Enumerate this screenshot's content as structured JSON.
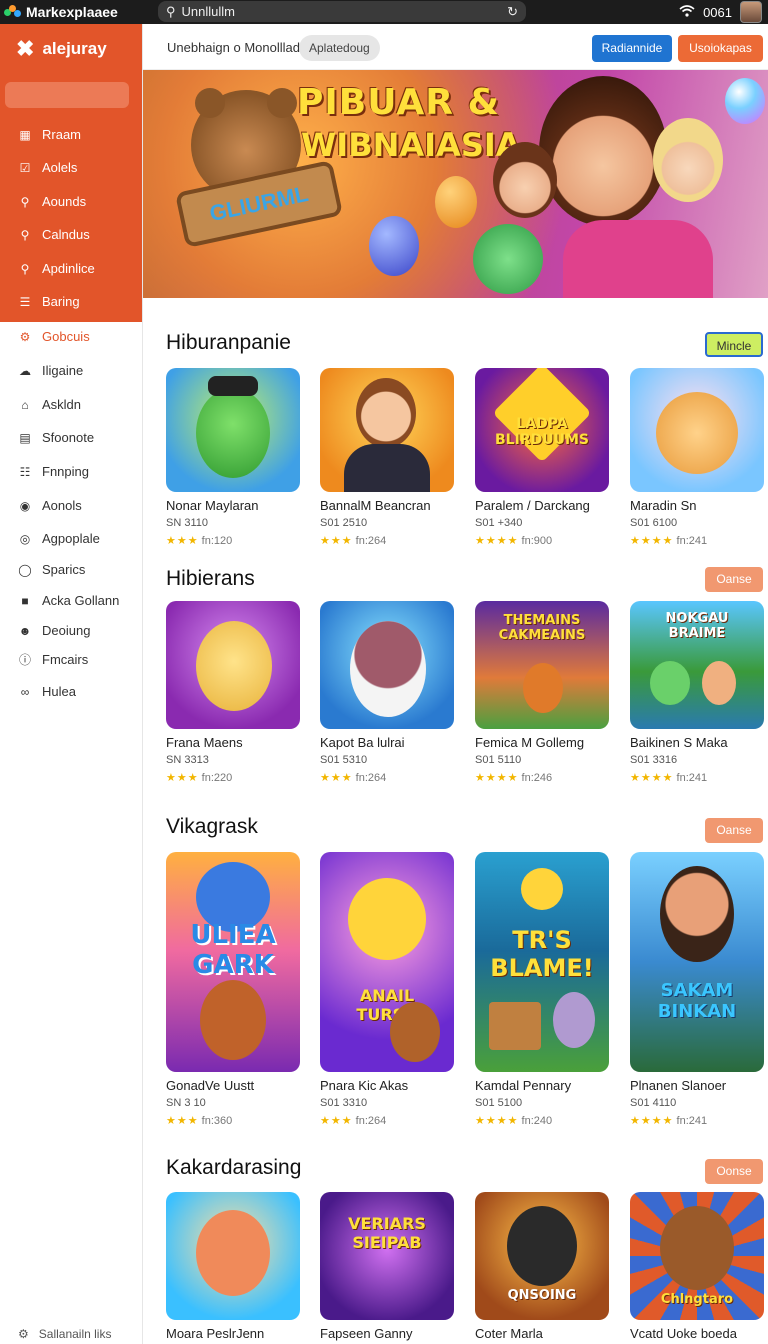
{
  "topbar": {
    "app_name": "Markexplaaee",
    "url": "Unnllullm",
    "clock": "0061"
  },
  "sidebar": {
    "logo": "alejuray",
    "items": [
      {
        "label": "Rraam",
        "icon": "grid-icon"
      },
      {
        "label": "Aolels",
        "icon": "checkbox-icon"
      },
      {
        "label": "Aounds",
        "icon": "search-icon"
      },
      {
        "label": "Calndus",
        "icon": "search-icon"
      },
      {
        "label": "Apdinlice",
        "icon": "search-icon"
      },
      {
        "label": "Baring",
        "icon": "list-icon"
      },
      {
        "label": "Gobcuis",
        "icon": "gear-icon"
      },
      {
        "label": "Iligaine",
        "icon": "cloud-icon"
      },
      {
        "label": "Askldn",
        "icon": "store-icon"
      },
      {
        "label": "Sfoonote",
        "icon": "note-icon"
      },
      {
        "label": "Fnnping",
        "icon": "doc-icon"
      },
      {
        "label": "Aonols",
        "icon": "globe-icon"
      },
      {
        "label": "Agpoplale",
        "icon": "target-icon"
      },
      {
        "label": "Sparics",
        "icon": "circle-icon"
      },
      {
        "label": "Acka Gollann",
        "icon": "gift-icon"
      },
      {
        "label": "Deoiung",
        "icon": "users-icon"
      },
      {
        "label": "Fmcairs",
        "icon": "info-icon"
      },
      {
        "label": "Hulea",
        "icon": "link-icon"
      }
    ],
    "footer": "Sallanailn liks"
  },
  "header": {
    "breadcrumb": "Unebhaign o Monolllade",
    "pill": "Aplatedoug",
    "btn_primary": "Radiannide",
    "btn_secondary": "Usoiokapas"
  },
  "banner": {
    "title_line1": "PIBUAR &",
    "title_line2": "WIBNAIASIA",
    "sign": "GLIURML"
  },
  "sections": [
    {
      "title": "Hiburanpanie",
      "button": "Mincle",
      "cards": [
        {
          "name": "Nonar Maylaran",
          "price": "SN 3110",
          "rating": "fn:120",
          "badge": ""
        },
        {
          "name": "BannalM Beancran",
          "price": "S01 2510",
          "rating": "fn:264",
          "badge": ""
        },
        {
          "name": "Paralem / Darckang",
          "price": "S01 +340",
          "rating": "fn:900",
          "badge": "LADPA BLIRDUUMS"
        },
        {
          "name": "Maradin Sn",
          "price": "S01 6100",
          "rating": "fn:241",
          "badge": ""
        }
      ]
    },
    {
      "title": "Hibierans",
      "button": "Oanse",
      "cards": [
        {
          "name": "Frana Maens",
          "price": "SN 3313",
          "rating": "fn:220",
          "badge": ""
        },
        {
          "name": "Kapot Ba lulrai",
          "price": "S01 5310",
          "rating": "fn:264",
          "badge": ""
        },
        {
          "name": "Femica M Gollemg",
          "price": "S01 5110",
          "rating": "fn:246",
          "badge": "THEMAINS CAKMEAINS"
        },
        {
          "name": "Baikinen S Maka",
          "price": "S01 3316",
          "rating": "fn:241",
          "badge": "NOKGAU BRAIME"
        }
      ]
    },
    {
      "title": "Vikagrask",
      "button": "Oanse",
      "cards": [
        {
          "name": "GonadVe Uustt",
          "price": "SN 3 10",
          "rating": "fn:360",
          "badge": "ULIEA GARK"
        },
        {
          "name": "Pnara Kic Akas",
          "price": "S01 3310",
          "rating": "fn:264",
          "badge": "ANAIL TURSH"
        },
        {
          "name": "Kamdal Pennary",
          "price": "S01 5100",
          "rating": "fn:240",
          "badge": "TR'S BLAME!"
        },
        {
          "name": "Plnanen Slanoer",
          "price": "S01 4110",
          "rating": "fn:241",
          "badge": "SAKAM BINKAN"
        }
      ]
    },
    {
      "title": "Kakardarasing",
      "button": "Oonse",
      "cards": [
        {
          "name": "Moara PeslrJenn",
          "price": "",
          "rating": "",
          "badge": ""
        },
        {
          "name": "Fapseen Ganny",
          "price": "",
          "rating": "",
          "badge": "VERIARS SIEIPAB"
        },
        {
          "name": "Coter Marla",
          "price": "",
          "rating": "",
          "badge": "QNSOING"
        },
        {
          "name": "Vcatd Uoke boeda",
          "price": "",
          "rating": "",
          "badge": "Chlngtaro"
        }
      ]
    }
  ],
  "colors": {
    "accent_orange": "#e2552a",
    "button_blue": "#1f74d1",
    "button_orange": "#ec6a36",
    "star": "#f2b600"
  }
}
